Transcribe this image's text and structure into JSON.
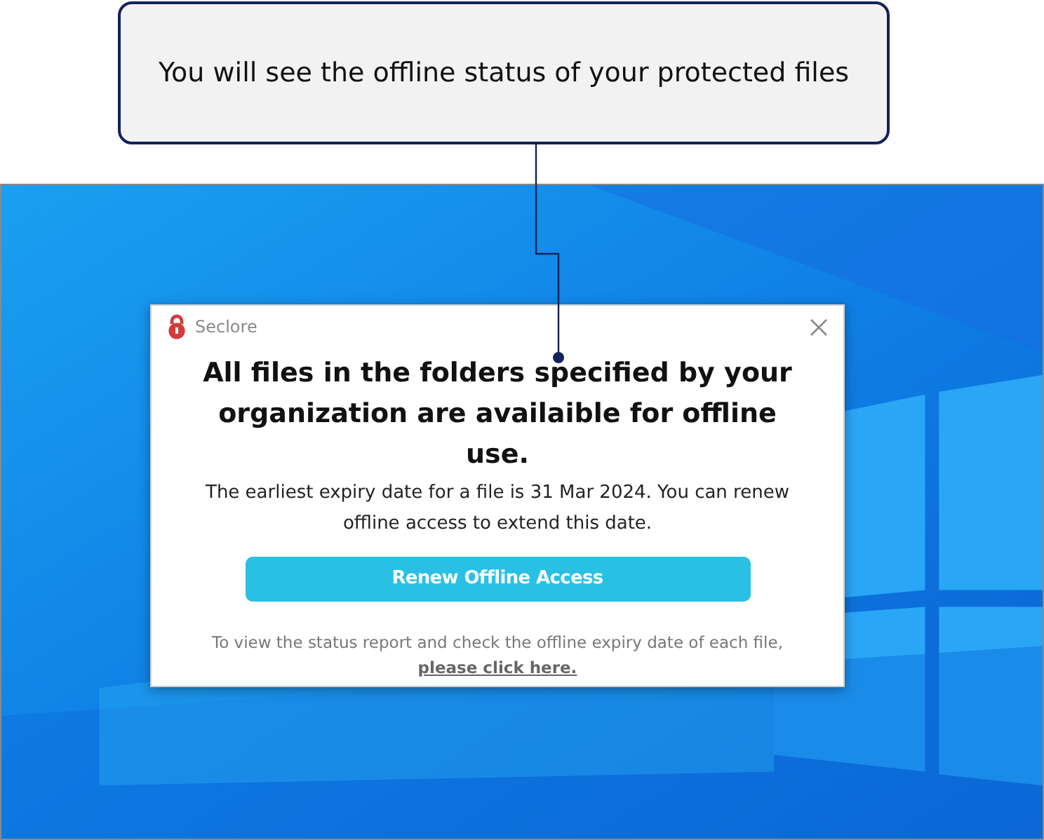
{
  "callout": {
    "text": "You will see the offline status of your protected files"
  },
  "dialog": {
    "app_name": "Seclore",
    "heading": "All files in the folders specified by your organization are availaible for offline use.",
    "message": "The earliest expiry date for a file is 31 Mar 2024. You can renew offline access to extend this date.",
    "button": "Renew Offline Access",
    "footer_text": "To view the status report and check the offline expiry date of each file,",
    "footer_link": "please click here."
  }
}
